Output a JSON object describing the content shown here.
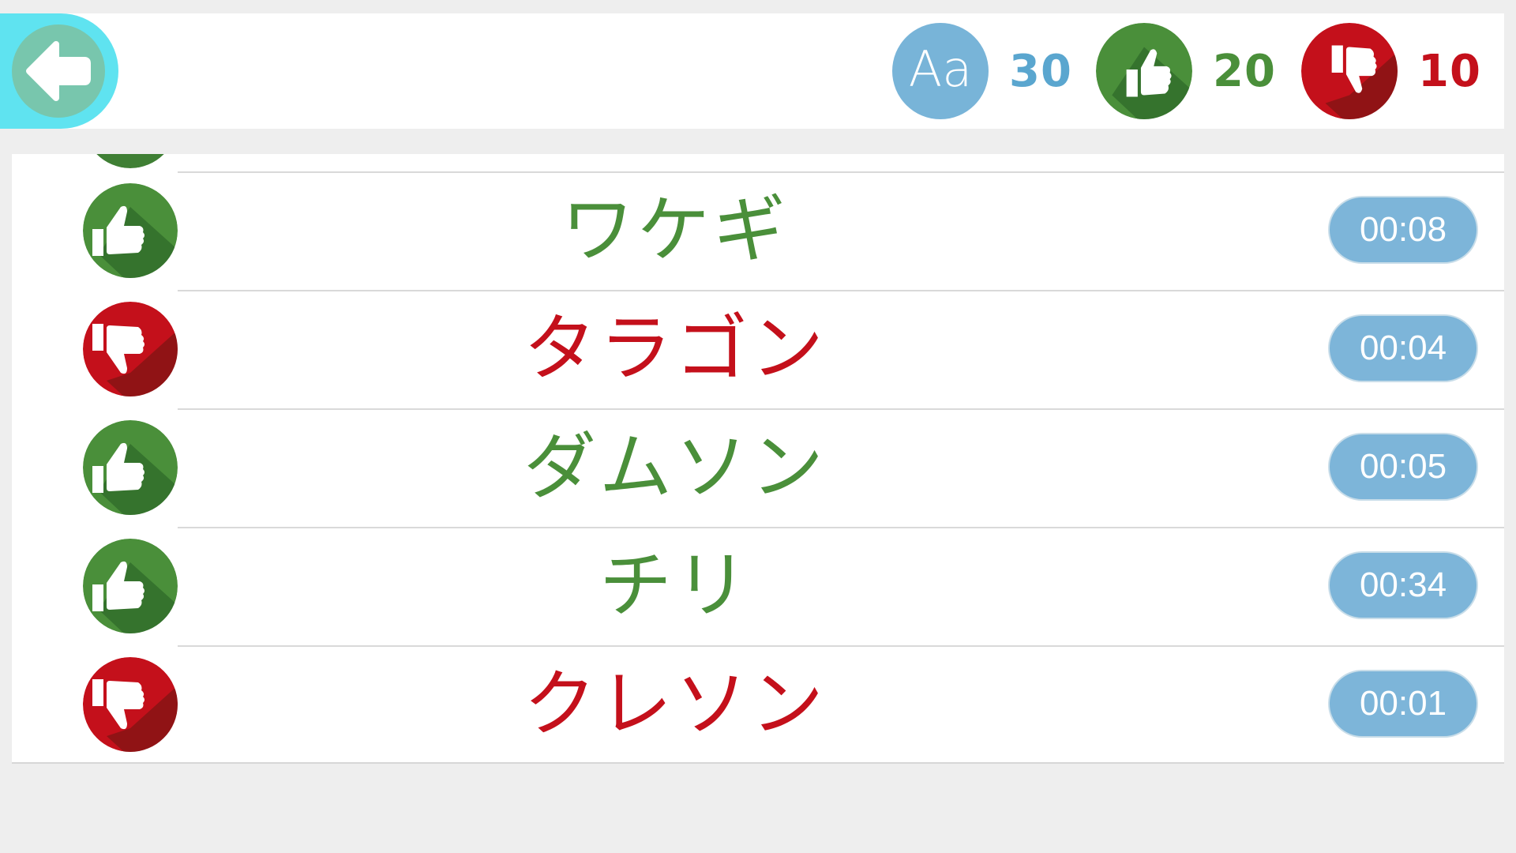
{
  "header": {
    "back_icon": "back-arrow-icon",
    "stats": {
      "total": {
        "icon": "font-aa-icon",
        "icon_text": "Aa",
        "value": "30",
        "color": "#5aa6cf"
      },
      "correct": {
        "icon": "thumbs-up-icon",
        "value": "20",
        "color": "#4a8f3a"
      },
      "wrong": {
        "icon": "thumbs-down-icon",
        "value": "10",
        "color": "#c4101b"
      }
    }
  },
  "results": [
    {
      "word": "ワケギ",
      "result": "correct",
      "time": "00:08"
    },
    {
      "word": "タラゴン",
      "result": "wrong",
      "time": "00:04"
    },
    {
      "word": "ダムソン",
      "result": "correct",
      "time": "00:05"
    },
    {
      "word": "チリ",
      "result": "correct",
      "time": "00:34"
    },
    {
      "word": "クレソン",
      "result": "wrong",
      "time": "00:01"
    }
  ],
  "colors": {
    "correct": "#4a8f3a",
    "wrong": "#c4101b",
    "accent": "#5fe3f0",
    "pill": "#7db5d9"
  }
}
